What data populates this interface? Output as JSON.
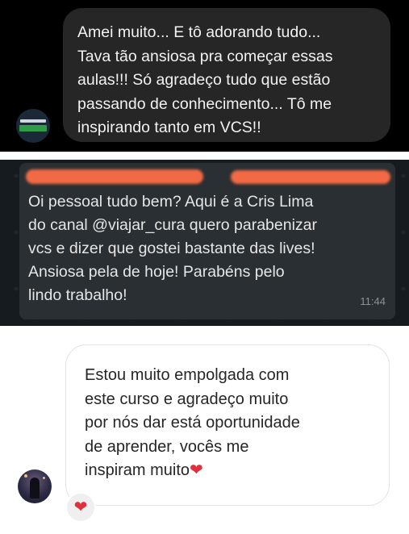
{
  "messages": [
    {
      "lines": [
        "Amei muito... E tô adorando tudo...",
        "Tava tão ansiosa pra começar essas",
        "aulas!!! Só agradeço tudo que estão",
        "passando de conhecimento... Tô me",
        "inspirando tanto em VCS!!"
      ]
    },
    {
      "lines": [
        "Oi pessoal tudo bem? Aqui é a Cris Lima",
        "do canal @viajar_cura quero parabenizar",
        "vcs e dizer que gostei bastante das lives!",
        "Ansiosa pela de hoje! Parabéns pelo",
        "lindo trabalho!"
      ],
      "time": "11:44"
    },
    {
      "lines": [
        "Estou muito empolgada com",
        "este curso e agradeço muito",
        "por nós dar está oportunidade",
        "de aprender, vocês me",
        "inspiram muito"
      ],
      "emoji": "❤",
      "reaction": "❤"
    }
  ],
  "icons": {
    "panel1_avatar": "brand-logo-avatar",
    "panel3_avatar": "user-avatar",
    "reaction": "heart-reaction-icon"
  },
  "colors": {
    "dark_bubble": "#262626",
    "whatsapp_bubble": "#2a2f33",
    "redaction": "#f26a45",
    "heart": "#e0303c"
  }
}
